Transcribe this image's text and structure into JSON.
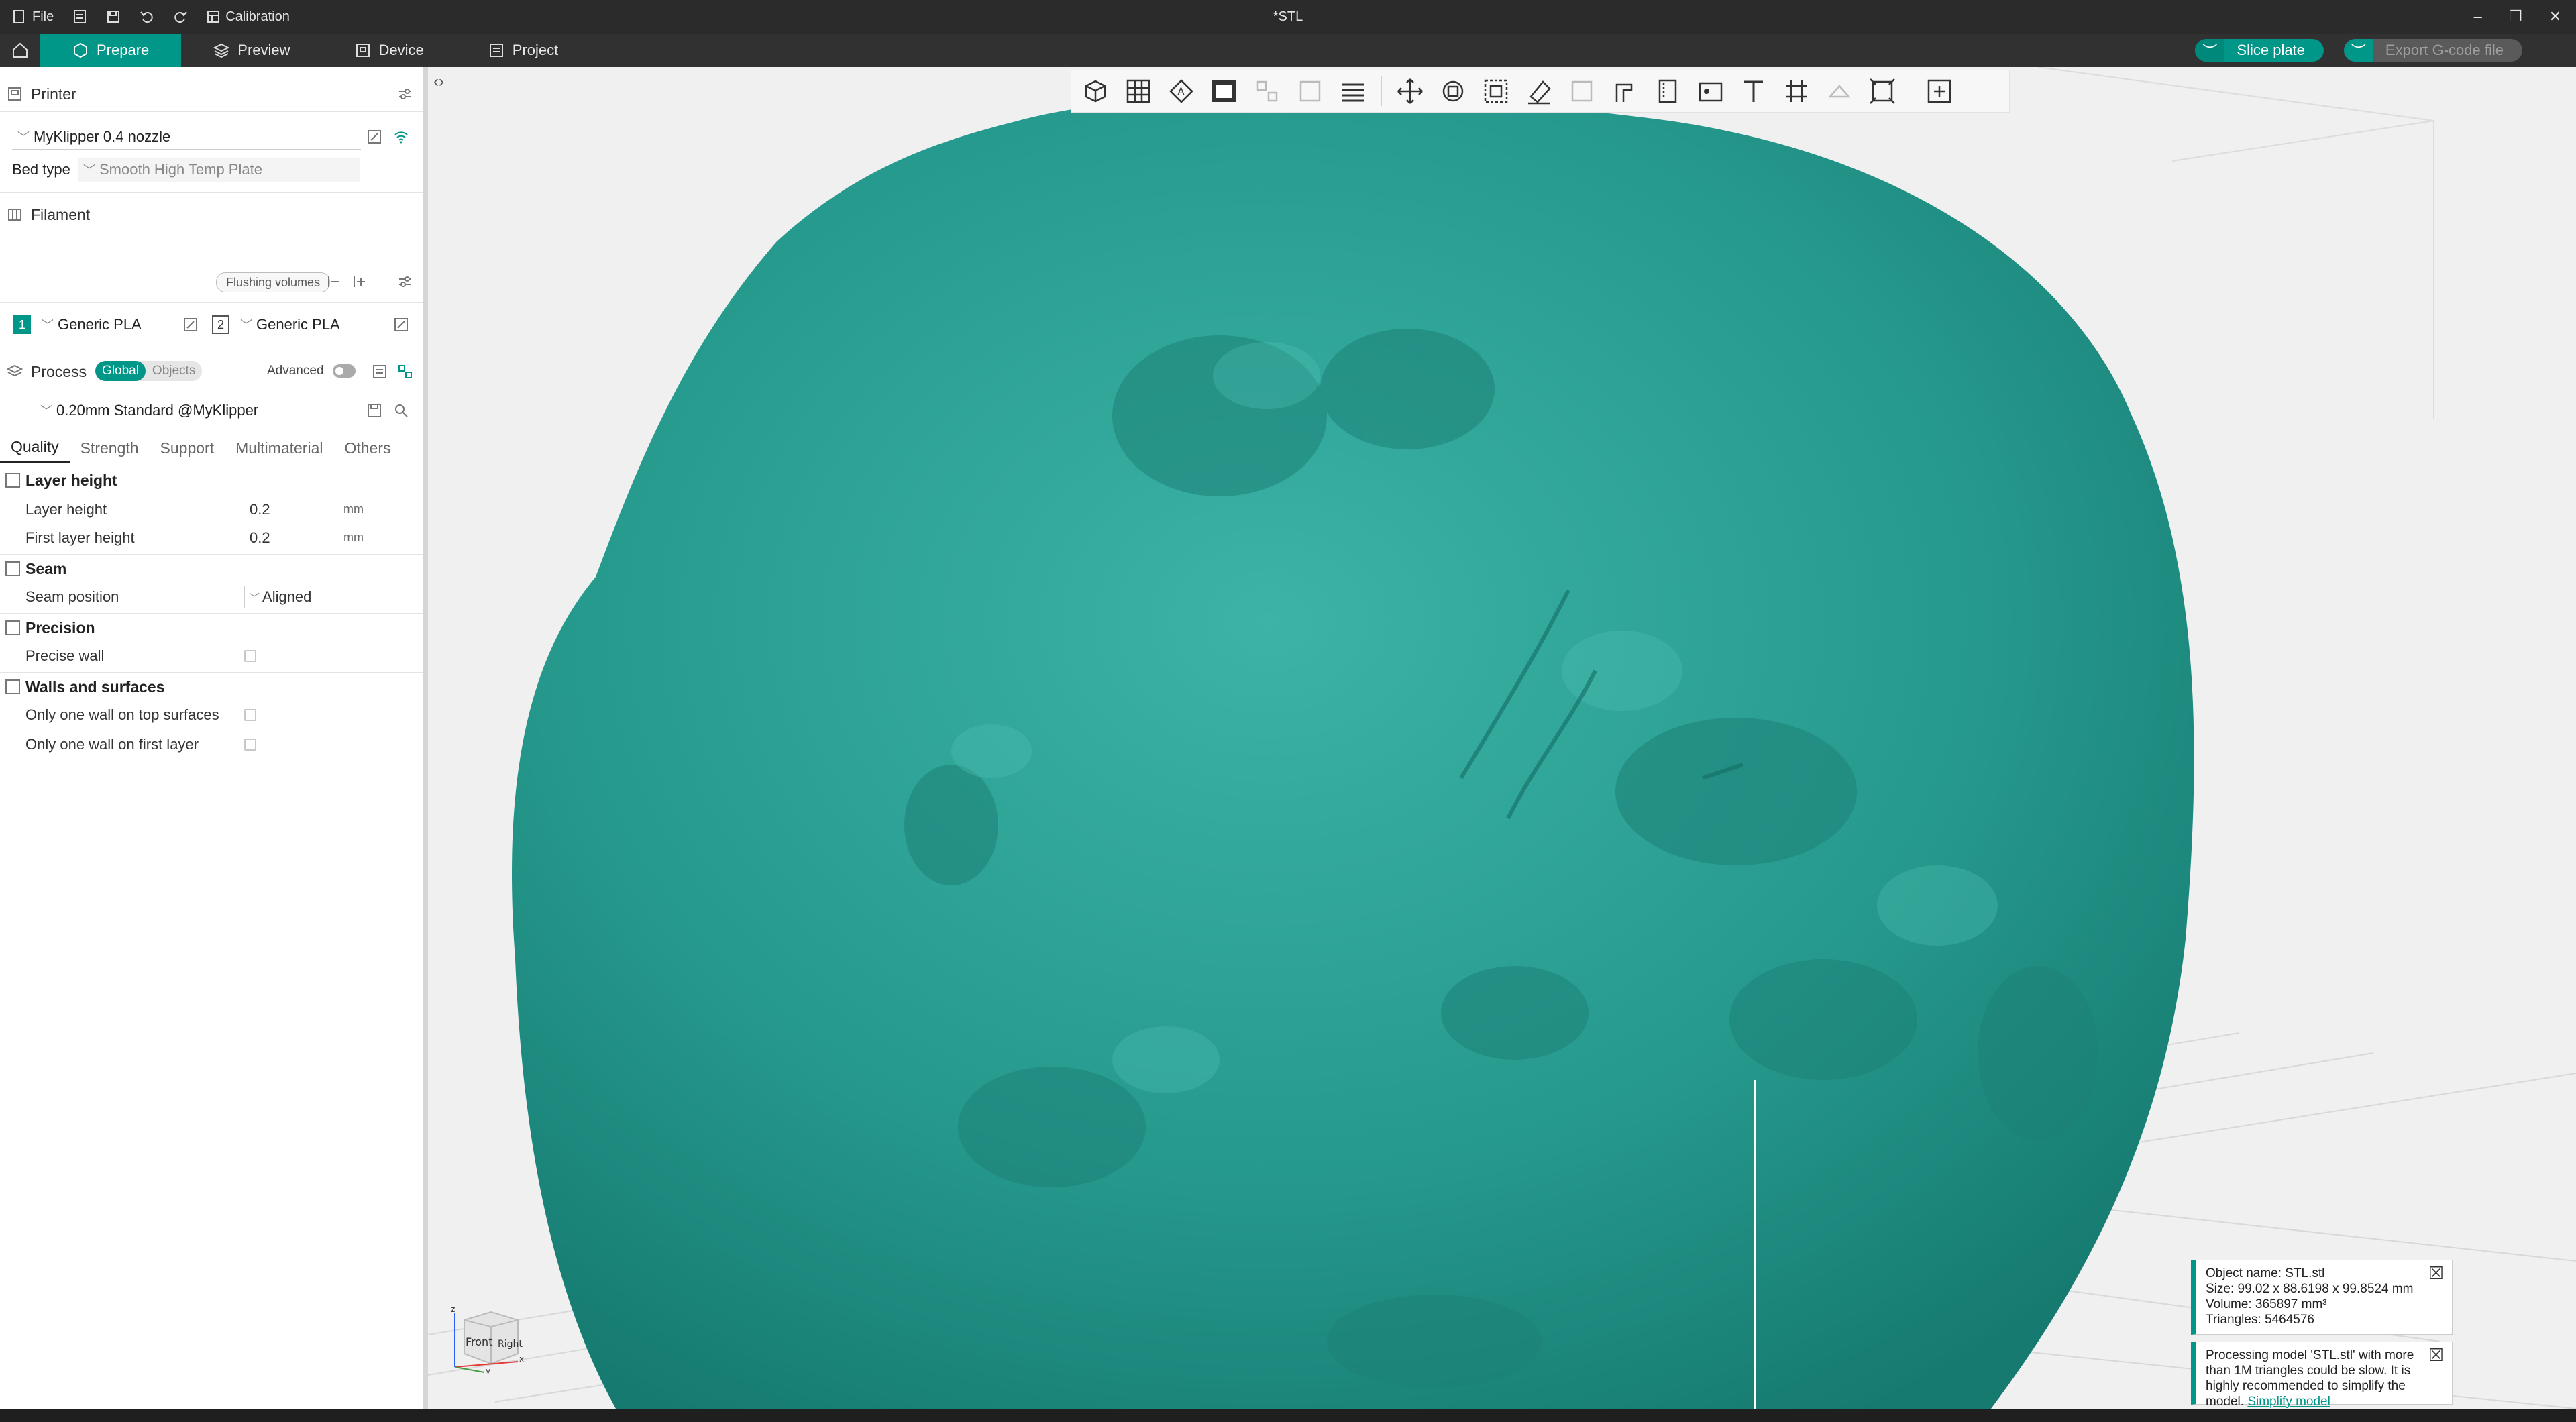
{
  "titlebar": {
    "file": "File",
    "calibration": "Calibration",
    "doc_title": "*STL"
  },
  "menubar": {
    "tabs": [
      "Prepare",
      "Preview",
      "Device",
      "Project"
    ],
    "slice": "Slice plate",
    "export": "Export G-code file"
  },
  "printer": {
    "heading": "Printer",
    "name": "MyKlipper 0.4 nozzle",
    "bed_label": "Bed type",
    "bed_value": "Smooth High Temp Plate"
  },
  "filament": {
    "heading": "Filament",
    "flushing": "Flushing volumes",
    "slots": [
      {
        "num": "1",
        "name": "Generic PLA",
        "color": "#009688"
      },
      {
        "num": "2",
        "name": "Generic PLA",
        "color": "#ffffff"
      }
    ]
  },
  "process": {
    "heading": "Process",
    "global": "Global",
    "objects": "Objects",
    "advanced": "Advanced",
    "profile": "0.20mm Standard @MyKlipper"
  },
  "tabs": [
    "Quality",
    "Strength",
    "Support",
    "Multimaterial",
    "Others"
  ],
  "quality": {
    "layer_height_group": "Layer height",
    "layer_height_label": "Layer height",
    "layer_height_value": "0.2",
    "first_layer_label": "First layer height",
    "first_layer_value": "0.2",
    "unit": "mm",
    "seam_group": "Seam",
    "seam_position_label": "Seam position",
    "seam_position_value": "Aligned",
    "precision_group": "Precision",
    "precise_wall_label": "Precise wall",
    "walls_group": "Walls and surfaces",
    "one_wall_top_label": "Only one wall on top surfaces",
    "one_wall_first_label": "Only one wall on first layer"
  },
  "cube": {
    "front": "Front",
    "right": "Right",
    "z": "z",
    "x": "x",
    "y": "y"
  },
  "info": {
    "object_name": "Object name: STL.stl",
    "size": "Size: 99.02 x 88.6198 x 99.8524 mm",
    "volume": "Volume: 365897 mm³",
    "triangles": "Triangles: 5464576"
  },
  "warning": {
    "text": "Processing model 'STL.stl' with more than 1M triangles could be slow. It is highly recommended to simplify the model.",
    "link": "Simplify model"
  },
  "colors": {
    "accent": "#009688",
    "model": "#2a9e93"
  }
}
